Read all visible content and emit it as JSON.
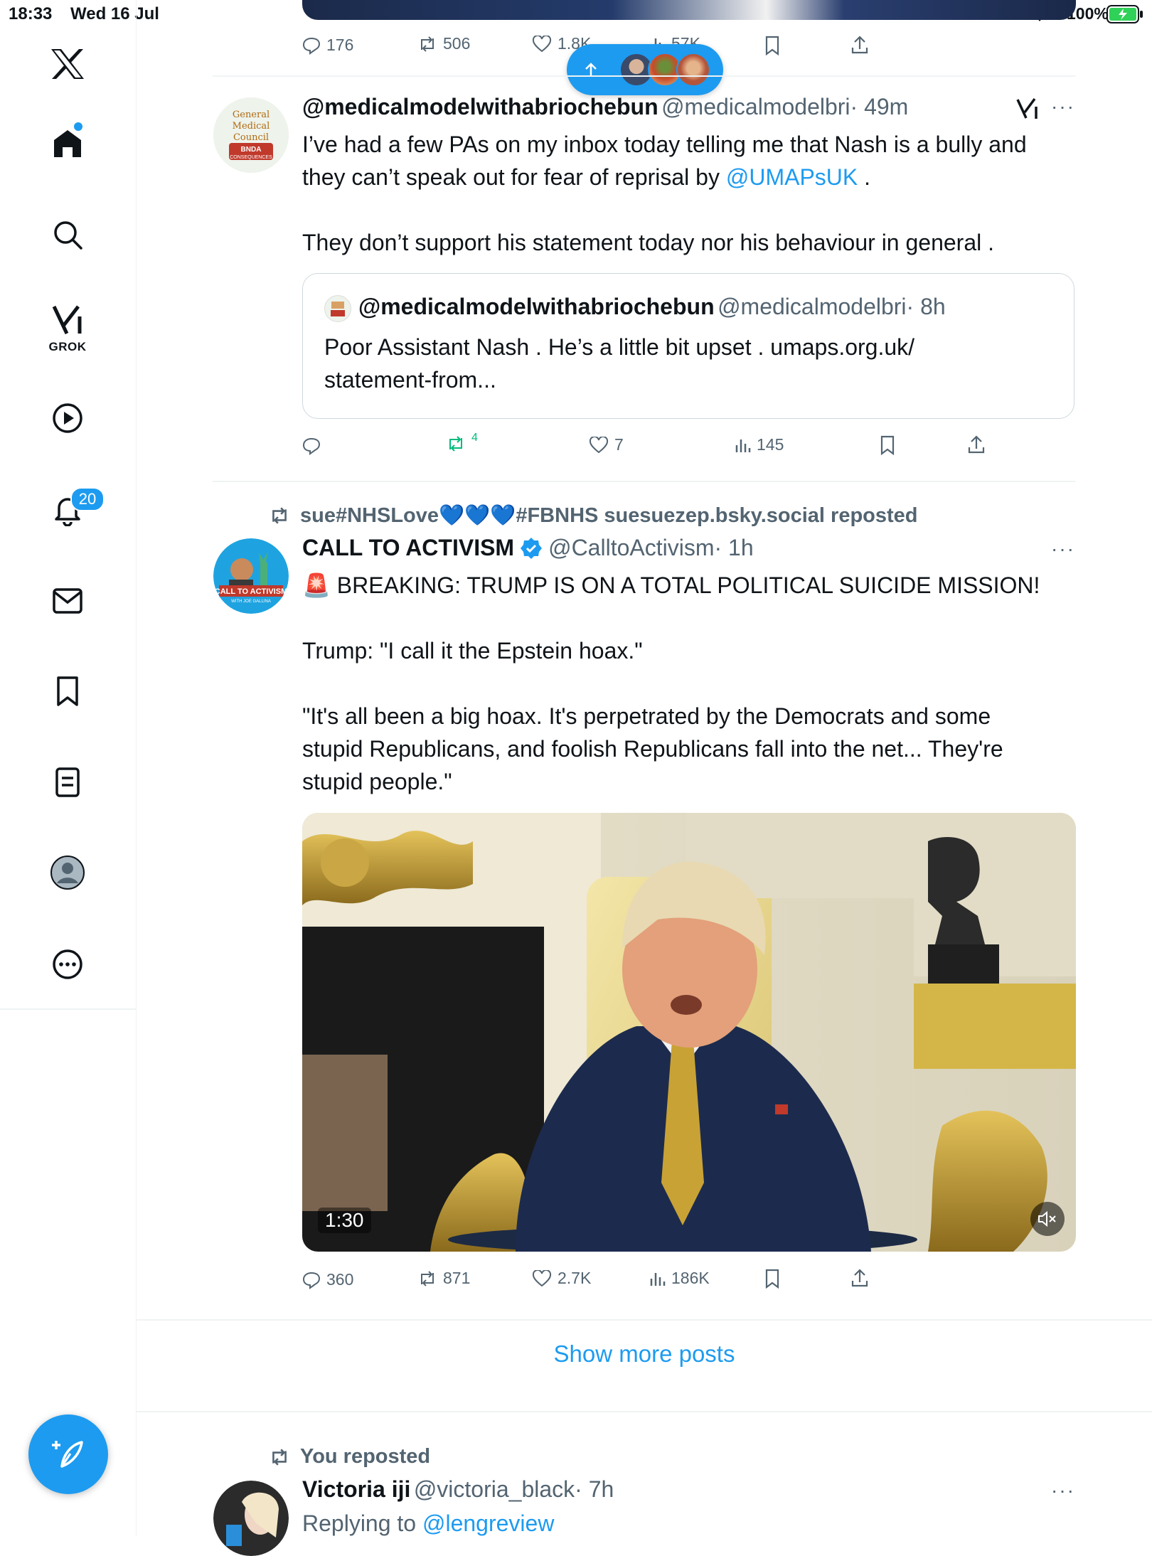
{
  "status_bar": {
    "time": "18:33",
    "date": "Wed 16 Jul",
    "battery": "100%"
  },
  "sidebar": {
    "grok_label": "GROK",
    "notification_count": "20",
    "icons": [
      "x-logo-icon",
      "home-icon",
      "search-icon",
      "grok-icon",
      "video-icon",
      "bell-icon",
      "mail-icon",
      "bookmark-icon",
      "lists-icon",
      "profile-icon",
      "more-icon"
    ]
  },
  "new_posts_pill": {
    "icon": "arrow-up-icon"
  },
  "top_post_actions": {
    "replies": "176",
    "reposts": "506",
    "likes": "1.8K",
    "views": "57K"
  },
  "post1": {
    "display_name": "@medicalmodelwithabriochebun",
    "handle": "@medicalmodelbri",
    "time": "· 49m",
    "text_line1": "I’ve had a few PAs on my inbox today telling me that Nash is a bully and",
    "text_line2_prefix": "they can’t speak out for fear of reprisal by ",
    "text_line2_link": "@UMAPsUK",
    "text_line2_suffix": " .",
    "text_line3": "They don’t support his statement today nor his behaviour in general .",
    "avatar_lines": [
      "General",
      "Medical",
      "Council",
      "BNDA",
      "CONSEQUENCES"
    ],
    "quote": {
      "display_name": "@medicalmodelwithabriochebun",
      "handle": "@medicalmodelbri",
      "time": "· 8h",
      "text_line1": "Poor Assistant Nash . He’s a little bit upset . umaps.org.uk/",
      "text_line2": "statement-from..."
    },
    "actions": {
      "replies": "",
      "reposts": "4",
      "likes": "7",
      "views": "145"
    }
  },
  "post2": {
    "reposted_by": "sue#NHSLove💙💙💙#FBNHS suesuezep.bsky.social reposted",
    "display_name": "CALL TO ACTIVISM",
    "handle": "@CalltoActivism",
    "time": "· 1h",
    "verified": true,
    "text_line1": "🚨 BREAKING: TRUMP IS ON A TOTAL POLITICAL SUICIDE MISSION!",
    "text_line2": "Trump: \"I call it the Epstein hoax.\"",
    "text_line3": "\"It's all been a big hoax. It's perpetrated by the Democrats and some",
    "text_line4": "stupid Republicans, and foolish Republicans fall into the net... They're",
    "text_line5": "stupid people.\"",
    "avatar_lines": [
      "CALL TO ACTIVISM",
      "WITH JOE GALLINA"
    ],
    "video_duration": "1:30",
    "actions": {
      "replies": "360",
      "reposts": "871",
      "likes": "2.7K",
      "views": "186K"
    }
  },
  "show_more": "Show more posts",
  "post3": {
    "reposted_by": "You reposted",
    "display_name": "Victoria iji",
    "handle": "@victoria_black",
    "time": "· 7h",
    "replying_prefix": "Replying to ",
    "replying_link": "@lengreview"
  },
  "colors": {
    "accent": "#1d9bf0",
    "repost_green": "#00ba7c",
    "text_primary": "#0f1419",
    "text_secondary": "#536471",
    "border": "#eff3f4"
  }
}
